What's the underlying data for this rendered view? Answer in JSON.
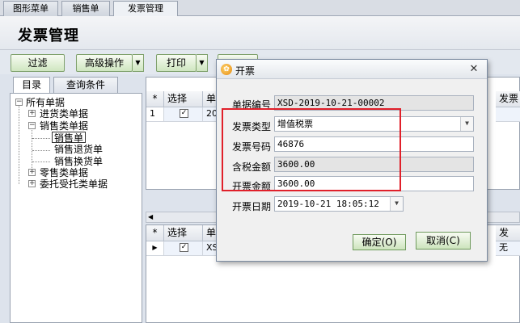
{
  "tabs": [
    {
      "label": "图形菜单"
    },
    {
      "label": "销售单"
    },
    {
      "label": "发票管理"
    }
  ],
  "page_title": "发票管理",
  "toolbar": {
    "filter": "过滤",
    "advanced": "高级操作",
    "print": "打印"
  },
  "left": {
    "tab_catalog": "目录",
    "tab_query": "查询条件",
    "tree": {
      "root": "所有单据",
      "purchase": "进货类单据",
      "sales": "销售类单据",
      "sales_order": "销售单",
      "sales_return": "销售退货单",
      "sales_exchange": "销售换货单",
      "retail": "零售类单据",
      "consign": "委托受托类单据"
    }
  },
  "grid_top": {
    "headers": {
      "star": "*",
      "select": "选择",
      "docno": "单",
      "invoice_amount": "发票"
    },
    "row": {
      "index": "1",
      "checked": "✓",
      "docno": "201"
    }
  },
  "grid_bottom": {
    "headers": {
      "star": "*",
      "select": "选择",
      "docno": "单",
      "right": "发"
    },
    "row": {
      "arrow": "▶",
      "checked": "✓",
      "docno": "XSD",
      "right": "无"
    }
  },
  "dialog": {
    "title": "开票",
    "close": "✕",
    "icon_glyph": "✿",
    "doc_no_label": "单据编号",
    "doc_no_value": "XSD-2019-10-21-00002",
    "invoice_type_label": "发票类型",
    "invoice_type_value": "增值税票",
    "invoice_no_label": "发票号码",
    "invoice_no_value": "46876",
    "tax_amount_label": "含税金额",
    "tax_amount_value": "3600.00",
    "invoice_amount_label": "开票金额",
    "invoice_amount_value": "3600.00",
    "invoice_date_label": "开票日期",
    "invoice_date_value": "2019-10-21 18:05:12",
    "ok": "确定(O)",
    "cancel": "取消(C)"
  },
  "colors": {
    "highlight_box": "#e0202a",
    "button_green": "#cde4bd"
  }
}
